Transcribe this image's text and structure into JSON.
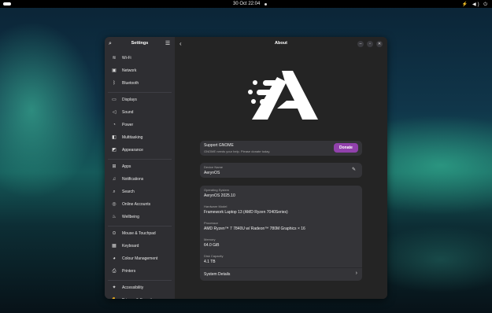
{
  "topbar": {
    "clock": "30 Oct  22:04",
    "system_icons": "⚡ ◀) ⏻"
  },
  "sidebar": {
    "title": "Settings",
    "search_icon": "search-icon",
    "menu_icon": "hamburger-menu-icon",
    "groups": [
      [
        {
          "label": "Wi-Fi",
          "icon": "wifi-icon"
        },
        {
          "label": "Network",
          "icon": "network-icon"
        },
        {
          "label": "Bluetooth",
          "icon": "bluetooth-icon"
        }
      ],
      [
        {
          "label": "Displays",
          "icon": "display-icon"
        },
        {
          "label": "Sound",
          "icon": "sound-icon"
        },
        {
          "label": "Power",
          "icon": "power-icon"
        },
        {
          "label": "Multitasking",
          "icon": "multitasking-icon"
        },
        {
          "label": "Appearance",
          "icon": "appearance-icon"
        }
      ],
      [
        {
          "label": "Apps",
          "icon": "apps-icon"
        },
        {
          "label": "Notifications",
          "icon": "bell-icon"
        },
        {
          "label": "Search",
          "icon": "search-icon"
        },
        {
          "label": "Online Accounts",
          "icon": "accounts-icon"
        },
        {
          "label": "Wellbeing",
          "icon": "wellbeing-icon"
        }
      ],
      [
        {
          "label": "Mouse & Touchpad",
          "icon": "mouse-icon"
        },
        {
          "label": "Keyboard",
          "icon": "keyboard-icon"
        },
        {
          "label": "Colour Management",
          "icon": "color-icon"
        },
        {
          "label": "Printers",
          "icon": "printer-icon"
        }
      ],
      [
        {
          "label": "Accessibility",
          "icon": "accessibility-icon"
        },
        {
          "label": "Privacy & Security",
          "icon": "privacy-icon"
        }
      ]
    ]
  },
  "content": {
    "title": "About",
    "support": {
      "title": "Support GNOME",
      "subtitle": "GNOME needs your help. Please donate today.",
      "button": "Donate"
    },
    "device_name": {
      "label": "Device Name",
      "value": "AerynOS"
    },
    "specs": [
      {
        "label": "Operating System",
        "value": "AerynOS 2025.10"
      },
      {
        "label": "Hardware Model",
        "value": "Framework Laptop 13 (AMD Ryzen 7040Series)"
      },
      {
        "label": "Processor",
        "value": "AMD Ryzen™ 7 7840U w/ Radeon™ 780M Graphics × 16"
      },
      {
        "label": "Memory",
        "value": "64.0 GiB"
      },
      {
        "label": "Disk Capacity",
        "value": "4.1 TB"
      }
    ],
    "system_details": "System Details"
  }
}
